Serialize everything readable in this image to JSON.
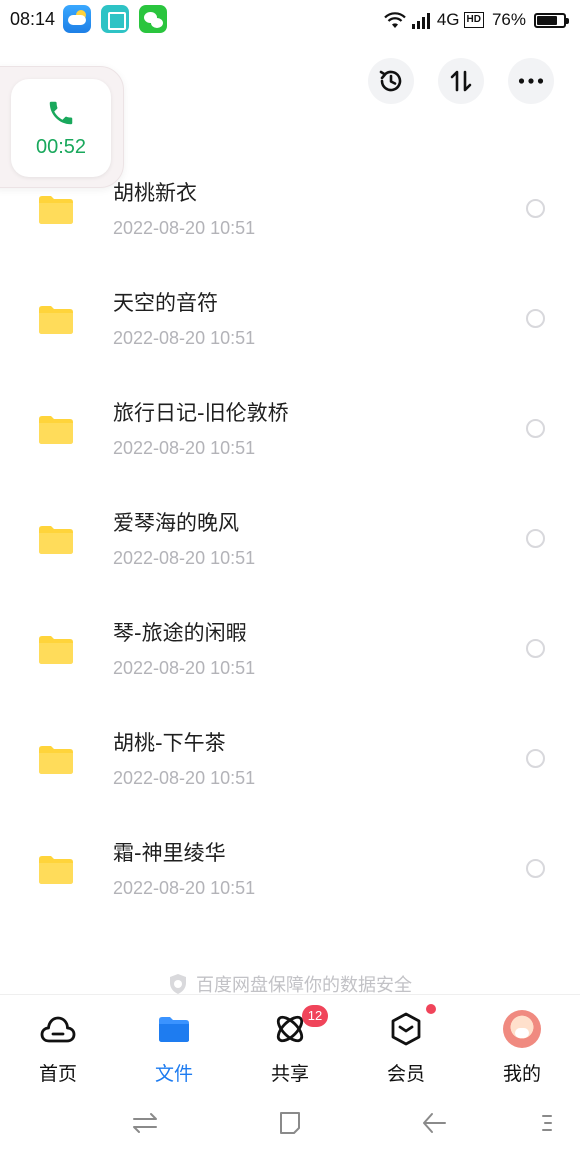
{
  "status_bar": {
    "time": "08:14",
    "network": "4G",
    "hd": "HD",
    "battery": "76%",
    "battery_level": 0.76
  },
  "call_float": {
    "duration": "00:52",
    "icon": "phone-icon"
  },
  "header": {
    "actions": [
      "history-icon",
      "sort-icon",
      "more-icon"
    ]
  },
  "files": [
    {
      "name": "胡桃新衣",
      "date": "2022-08-20  10:51"
    },
    {
      "name": "天空的音符",
      "date": "2022-08-20  10:51"
    },
    {
      "name": "旅行日记-旧伦敦桥",
      "date": "2022-08-20  10:51"
    },
    {
      "name": "爱琴海的晚风",
      "date": "2022-08-20  10:51"
    },
    {
      "name": "琴-旅途的闲暇",
      "date": "2022-08-20  10:51"
    },
    {
      "name": "胡桃-下午茶",
      "date": "2022-08-20  10:51"
    },
    {
      "name": "霜-神里绫华",
      "date": "2022-08-20  10:51"
    }
  ],
  "security_note": "百度网盘保障你的数据安全",
  "bottom_nav": {
    "items": [
      {
        "label": "首页",
        "active": false
      },
      {
        "label": "文件",
        "active": true
      },
      {
        "label": "共享",
        "active": false
      },
      {
        "label": "会员",
        "active": false
      },
      {
        "label": "我的",
        "active": false
      }
    ],
    "share_badge": "12"
  },
  "colors": {
    "accent": "#1e7cf0",
    "folder": "#ffd43b",
    "call_green": "#19a85c",
    "badge": "#f0445a"
  }
}
